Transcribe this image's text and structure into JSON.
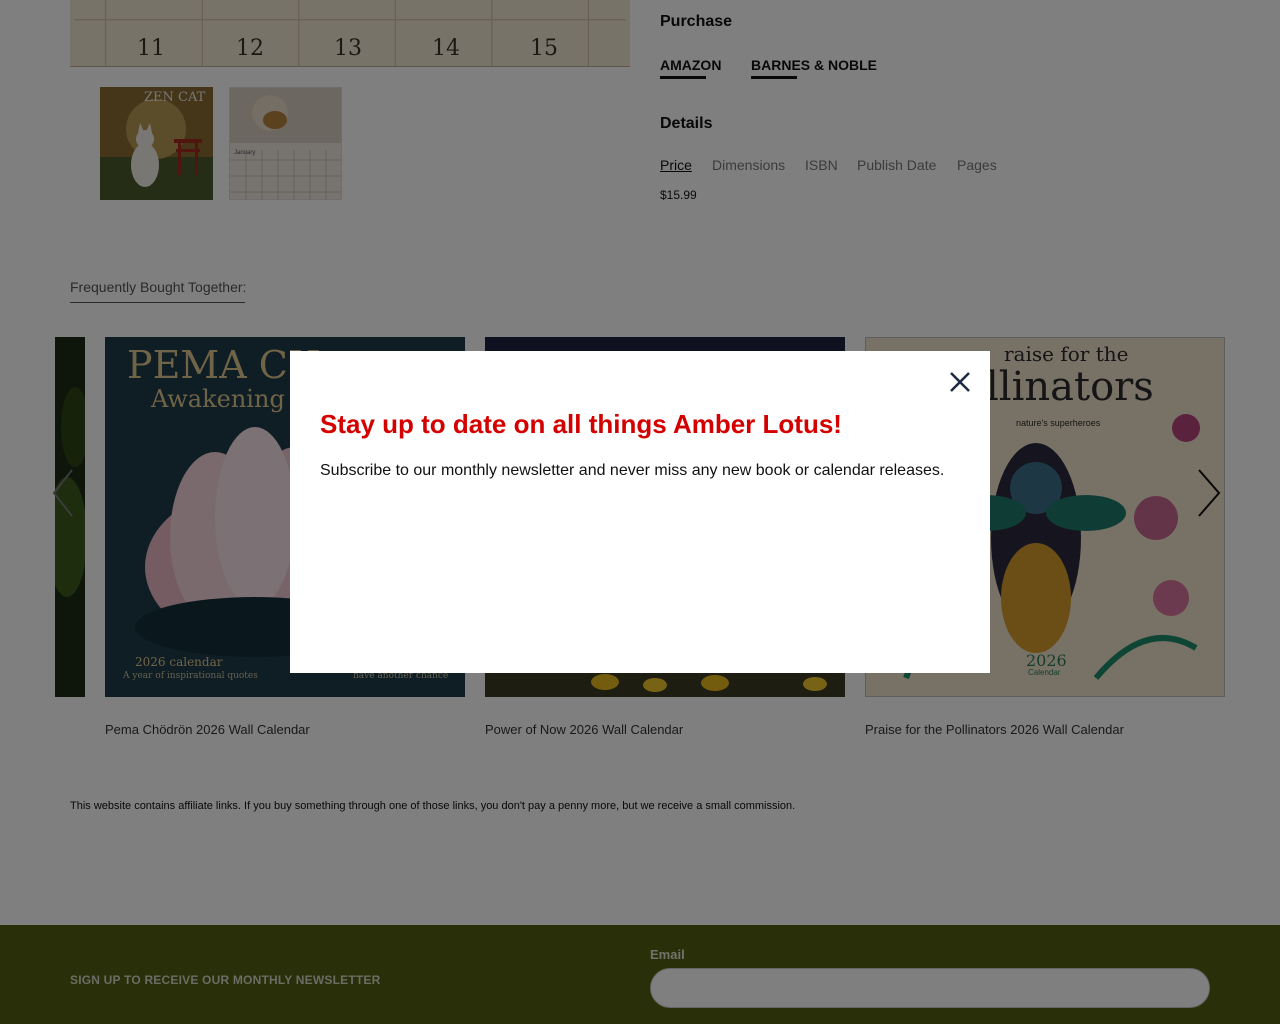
{
  "gallery": {
    "calendar_numbers": [
      "11",
      "12",
      "13",
      "14",
      "15"
    ],
    "thumbnail_1": {
      "title": "ZEN CAT"
    },
    "thumbnail_2": {
      "caption": "January"
    }
  },
  "purchase": {
    "heading": "Purchase",
    "links": [
      {
        "label": "AMAZON"
      },
      {
        "label": "BARNES & NOBLE"
      }
    ]
  },
  "details": {
    "heading": "Details",
    "tabs": [
      "Price",
      "Dimensions",
      "ISBN",
      "Publish Date",
      "Pages"
    ],
    "active_tab": "Price",
    "price_value": "$15.99"
  },
  "related": {
    "heading": "Frequently Bought Together:",
    "items": [
      {
        "title": "Pema Chödrön 2026 Wall Calendar",
        "cover_title": "PEMA CH",
        "cover_subtitle": "Awakening",
        "cover_year": "2026 calendar",
        "cover_tagline": "A year of inspirational quotes",
        "cover_note": "have another chance"
      },
      {
        "title": "Power of Now 2026 Wall Calendar"
      },
      {
        "title": "Praise for the Pollinators 2026 Wall Calendar",
        "cover_title_top": "raise for the",
        "cover_title_main": "llinators",
        "cover_subtitle": "nature's superheroes",
        "cover_year": "2026",
        "cover_label": "Calendar"
      }
    ]
  },
  "affiliate_notice": "This website contains affiliate links. If you buy something through one of those links, you don't pay a penny more, but we receive a small commission.",
  "footer": {
    "newsletter_label": "SIGN UP TO RECEIVE OUR MONTHLY NEWSLETTER",
    "email_label": "Email",
    "email_value": ""
  },
  "modal": {
    "title": "Stay up to date on all things Amber Lotus!",
    "text": "Subscribe to our monthly newsletter and never miss any new book or calendar releases."
  },
  "colors": {
    "modal_title": "#d40000",
    "footer_bg": "#525e10",
    "overlay": "rgba(0,0,0,0.5)"
  }
}
